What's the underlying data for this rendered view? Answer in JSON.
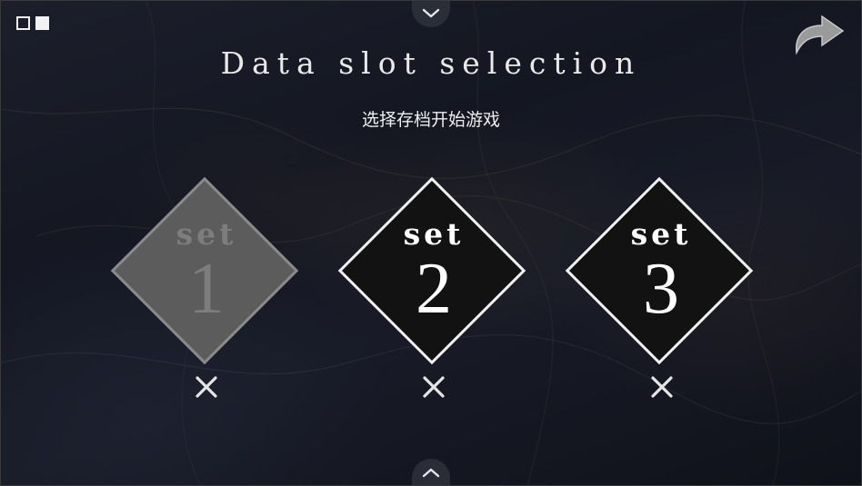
{
  "screen": {
    "title": "Data slot selection",
    "subtitle": "选择存档开始游戏"
  },
  "controls": {
    "view_toggle": [
      "outline-square-icon",
      "filled-square-icon"
    ],
    "top_tab_icon": "chevron-down-icon",
    "bottom_tab_icon": "chevron-up-icon",
    "back_icon": "curved-arrow-back-icon"
  },
  "slots": [
    {
      "label": "set",
      "number": "1",
      "state": "disabled",
      "delete_icon": "close-icon"
    },
    {
      "label": "set",
      "number": "2",
      "state": "available",
      "delete_icon": "close-icon"
    },
    {
      "label": "set",
      "number": "3",
      "state": "available",
      "delete_icon": "close-icon"
    }
  ],
  "colors": {
    "active_diamond_fill": "#121212",
    "active_diamond_border": "#f2f2f2",
    "inactive_diamond_fill": "#5c5c5c",
    "inactive_text": "#7d7d7d",
    "text": "#ffffff"
  }
}
